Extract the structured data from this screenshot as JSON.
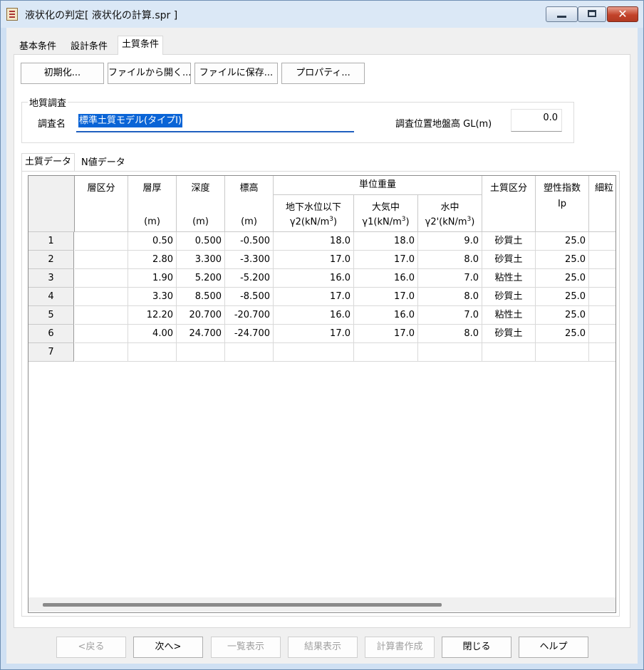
{
  "window": {
    "title": "液状化の判定[ 液状化の計算.spr ]",
    "close_glyph": "✕"
  },
  "tabs": [
    "基本条件",
    "設計条件",
    "土質条件"
  ],
  "toolbar": {
    "init_label": "初期化...",
    "open_label": "ファイルから開く...",
    "save_label": "ファイルに保存...",
    "props_label": "プロパティ..."
  },
  "survey": {
    "group_title": "地質調査",
    "name_label": "調査名",
    "name_value": "標準土質モデル(タイプⅠ)",
    "gl_label": "調査位置地盤高 GL(m)",
    "gl_value": "0.0"
  },
  "subtabs": [
    "土質データ",
    "N値データ"
  ],
  "table": {
    "headers": {
      "layer_class": "層区分",
      "thickness": "層厚",
      "thickness_unit": "(m)",
      "depth": "深度",
      "depth_unit": "(m)",
      "elevation": "標高",
      "elevation_unit": "(m)",
      "unit_weight": "単位重量",
      "gw_below": "地下水位以下",
      "gw_below_sym": "γ2(kN/m",
      "air": "大気中",
      "air_sym": "γ1(kN/m",
      "water": "水中",
      "water_sym": "γ2'(kN/m",
      "cube": "3",
      "close_paren": ")",
      "soil_class": "土質区分",
      "plasticity": "塑性指数",
      "plasticity_sym": "Ip",
      "fine": "細粒"
    },
    "rows": [
      {
        "no": "1",
        "thickness": "0.50",
        "depth": "0.500",
        "elevation": "-0.500",
        "g2": "18.0",
        "g1": "18.0",
        "g2p": "9.0",
        "soil": "砂質土",
        "ip": "25.0"
      },
      {
        "no": "2",
        "thickness": "2.80",
        "depth": "3.300",
        "elevation": "-3.300",
        "g2": "17.0",
        "g1": "17.0",
        "g2p": "8.0",
        "soil": "砂質土",
        "ip": "25.0"
      },
      {
        "no": "3",
        "thickness": "1.90",
        "depth": "5.200",
        "elevation": "-5.200",
        "g2": "16.0",
        "g1": "16.0",
        "g2p": "7.0",
        "soil": "粘性土",
        "ip": "25.0"
      },
      {
        "no": "4",
        "thickness": "3.30",
        "depth": "8.500",
        "elevation": "-8.500",
        "g2": "17.0",
        "g1": "17.0",
        "g2p": "8.0",
        "soil": "砂質土",
        "ip": "25.0"
      },
      {
        "no": "5",
        "thickness": "12.20",
        "depth": "20.700",
        "elevation": "-20.700",
        "g2": "16.0",
        "g1": "16.0",
        "g2p": "7.0",
        "soil": "粘性土",
        "ip": "25.0"
      },
      {
        "no": "6",
        "thickness": "4.00",
        "depth": "24.700",
        "elevation": "-24.700",
        "g2": "17.0",
        "g1": "17.0",
        "g2p": "8.0",
        "soil": "砂質土",
        "ip": "25.0"
      },
      {
        "no": "7",
        "thickness": "",
        "depth": "",
        "elevation": "",
        "g2": "",
        "g1": "",
        "g2p": "",
        "soil": "",
        "ip": ""
      }
    ]
  },
  "footer": {
    "back_label": "<戻る",
    "next_label": "次へ>",
    "list_label": "一覧表示",
    "result_label": "結果表示",
    "report_label": "計算書作成",
    "close_label": "閉じる",
    "help_label": "ヘルプ"
  }
}
